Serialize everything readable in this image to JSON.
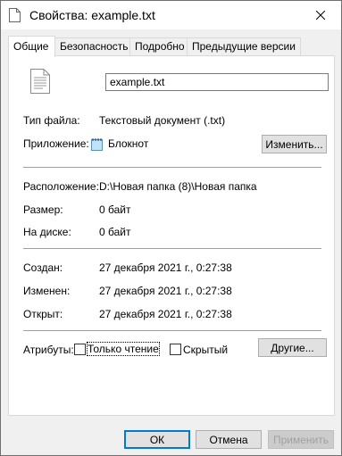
{
  "window": {
    "title": "Свойства: example.txt",
    "icons": {
      "title": "document-icon",
      "close": "close-icon"
    }
  },
  "tabs": [
    {
      "label": "Общие",
      "active": true
    },
    {
      "label": "Безопасность",
      "active": false
    },
    {
      "label": "Подробно",
      "active": false
    },
    {
      "label": "Предыдущие версии",
      "active": false
    }
  ],
  "general": {
    "filename": "example.txt",
    "file_type_label": "Тип файла:",
    "file_type_value": "Текстовый документ (.txt)",
    "app_label": "Приложение:",
    "app_value": "Блокнот",
    "change_button": "Изменить...",
    "location_label": "Расположение:",
    "location_value": "D:\\Новая папка (8)\\Новая папка",
    "size_label": "Размер:",
    "size_value": "0 байт",
    "disk_label": "На диске:",
    "disk_value": "0 байт",
    "created_label": "Создан:",
    "created_value": "27 декабря 2021 г., 0:27:38",
    "modified_label": "Изменен:",
    "modified_value": "27 декабря 2021 г., 0:27:38",
    "accessed_label": "Открыт:",
    "accessed_value": "27 декабря 2021 г., 0:27:38",
    "attributes_label": "Атрибуты:",
    "readonly_label": "Только чтение",
    "readonly_checked": false,
    "hidden_label": "Скрытый",
    "hidden_checked": false,
    "other_button": "Другие..."
  },
  "footer": {
    "ok": "ОК",
    "cancel": "Отмена",
    "apply": "Применить"
  },
  "colors": {
    "accent": "#0078d7",
    "panel_bg": "#ffffff",
    "window_bg": "#f0f0f0",
    "disabled_text": "#a0a0a0"
  }
}
